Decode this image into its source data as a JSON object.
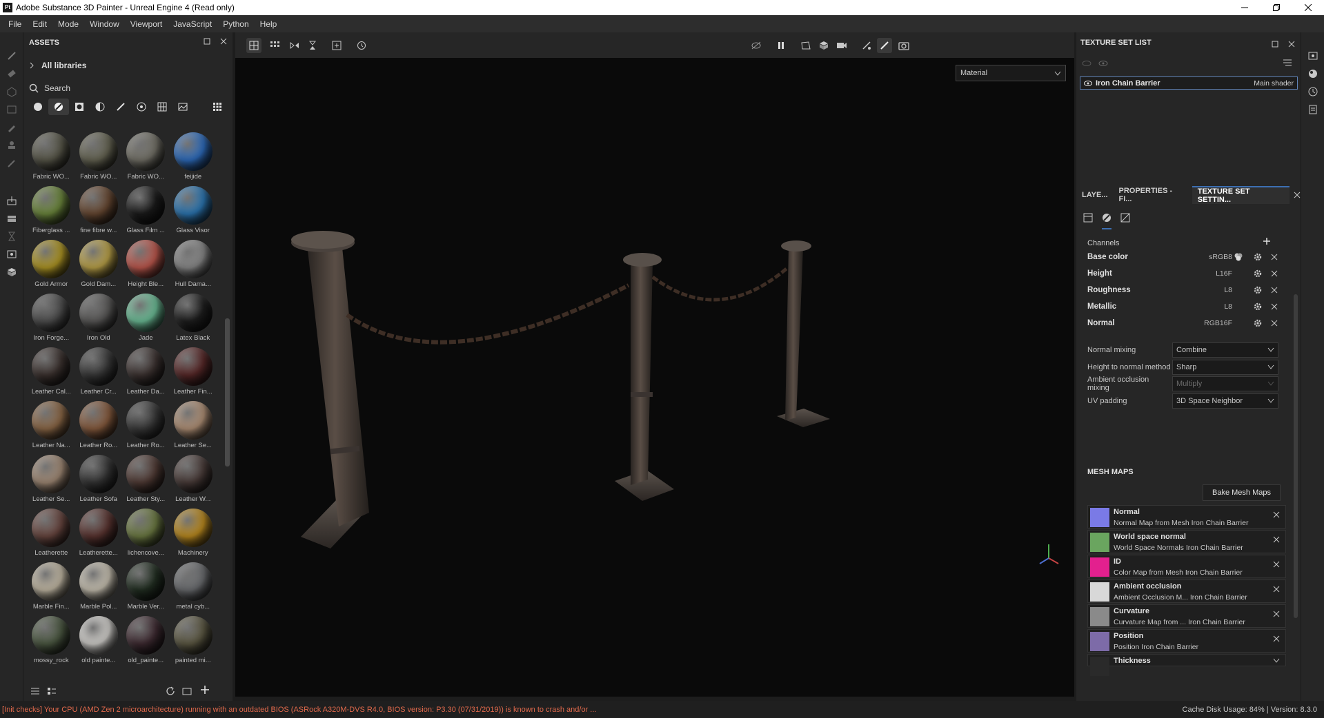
{
  "window": {
    "title": "Adobe Substance 3D Painter - Unreal Engine 4 (Read only)",
    "app_icon": "Pt"
  },
  "menu": [
    "File",
    "Edit",
    "Mode",
    "Window",
    "Viewport",
    "JavaScript",
    "Python",
    "Help"
  ],
  "assets": {
    "title": "ASSETS",
    "libraries_label": "All libraries",
    "search_placeholder": "Search",
    "items": [
      {
        "label": "Fabric WO...",
        "color": "#5b5a4c"
      },
      {
        "label": "Fabric WO...",
        "color": "#686755"
      },
      {
        "label": "Fabric WO...",
        "color": "#76746a"
      },
      {
        "label": "feijide",
        "color": "#2f6fc2"
      },
      {
        "label": "Fiberglass ...",
        "color": "#6f8b3e"
      },
      {
        "label": "fine fibre w...",
        "color": "#6a4a33"
      },
      {
        "label": "Glass Film ...",
        "color": "#1c1c1c"
      },
      {
        "label": "Glass Visor",
        "color": "#2d7ab8"
      },
      {
        "label": "Gold Armor",
        "color": "#b39a25"
      },
      {
        "label": "Gold Dam...",
        "color": "#bfa64a"
      },
      {
        "label": "Height Ble...",
        "color": "#c25a4f"
      },
      {
        "label": "Hull Dama...",
        "color": "#8c8c8c"
      },
      {
        "label": "Iron Forge...",
        "color": "#525252"
      },
      {
        "label": "Iron Old",
        "color": "#5c5b5a"
      },
      {
        "label": "Jade",
        "color": "#6fc39b"
      },
      {
        "label": "Latex Black",
        "color": "#1f1f1f"
      },
      {
        "label": "Leather Cal...",
        "color": "#3d3330"
      },
      {
        "label": "Leather Cr...",
        "color": "#3a3a3a"
      },
      {
        "label": "Leather Da...",
        "color": "#3e3432"
      },
      {
        "label": "Leather Fin...",
        "color": "#5a2929"
      },
      {
        "label": "Leather Na...",
        "color": "#8f6a48"
      },
      {
        "label": "Leather Ro...",
        "color": "#8a5d3f"
      },
      {
        "label": "Leather Ro...",
        "color": "#3b3b3b"
      },
      {
        "label": "Leather Se...",
        "color": "#b59479"
      },
      {
        "label": "Leather Se...",
        "color": "#a58d78"
      },
      {
        "label": "Leather Sofa",
        "color": "#353535"
      },
      {
        "label": "Leather Sty...",
        "color": "#523c36"
      },
      {
        "label": "Leather W...",
        "color": "#4b3d3a"
      },
      {
        "label": "Leatherette",
        "color": "#6b4841"
      },
      {
        "label": "Leatherette...",
        "color": "#5c3531"
      },
      {
        "label": "lichencove...",
        "color": "#6f7d44"
      },
      {
        "label": "Machinery",
        "color": "#c08e20"
      },
      {
        "label": "Marble Fin...",
        "color": "#c7bda8"
      },
      {
        "label": "Marble Pol...",
        "color": "#cdc6b6"
      },
      {
        "label": "Marble Ver...",
        "color": "#233023"
      },
      {
        "label": "metal cyb...",
        "color": "#6d6f72"
      },
      {
        "label": "mossy_rock",
        "color": "#4e5b44"
      },
      {
        "label": "old painte...",
        "color": "#d8d6d2"
      },
      {
        "label": "old_painte...",
        "color": "#402c33"
      },
      {
        "label": "painted mi...",
        "color": "#5f5b45"
      },
      {
        "label": "",
        "color": "#9a9898"
      },
      {
        "label": "",
        "color": "#8b6b4a"
      },
      {
        "label": "",
        "color": "#b3c2bd"
      },
      {
        "label": "",
        "color": "#3c3c3c"
      }
    ]
  },
  "viewport": {
    "display_mode": "Material"
  },
  "texture_set_list": {
    "title": "TEXTURE SET LIST",
    "item_name": "Iron Chain Barrier",
    "item_shader": "Main shader"
  },
  "tabs": [
    {
      "label": "LAYE..."
    },
    {
      "label": "PROPERTIES - FI..."
    },
    {
      "label": "TEXTURE SET SETTIN..."
    }
  ],
  "channels": {
    "title": "Channels",
    "items": [
      {
        "name": "Base color",
        "format": "sRGB8"
      },
      {
        "name": "Height",
        "format": "L16F"
      },
      {
        "name": "Roughness",
        "format": "L8"
      },
      {
        "name": "Metallic",
        "format": "L8"
      },
      {
        "name": "Normal",
        "format": "RGB16F"
      }
    ]
  },
  "properties": [
    {
      "label": "Normal mixing",
      "value": "Combine"
    },
    {
      "label": "Height to normal method",
      "value": "Sharp"
    },
    {
      "label": "Ambient occlusion mixing",
      "value": "Multiply"
    },
    {
      "label": "UV padding",
      "value": "3D Space Neighbor"
    }
  ],
  "mesh_maps": {
    "title": "MESH MAPS",
    "bake_button": "Bake Mesh Maps",
    "items": [
      {
        "name": "Normal",
        "desc": "Normal Map from Mesh Iron Chain Barrier",
        "color": "#7a7ae6"
      },
      {
        "name": "World space normal",
        "desc": "World Space Normals Iron Chain Barrier",
        "color": "#6aa55f"
      },
      {
        "name": "ID",
        "desc": "Color Map from Mesh Iron Chain Barrier",
        "color": "#e3208e"
      },
      {
        "name": "Ambient occlusion",
        "desc": "Ambient Occlusion M... Iron Chain Barrier",
        "color": "#d8d8d8"
      },
      {
        "name": "Curvature",
        "desc": "Curvature Map from ... Iron Chain Barrier",
        "color": "#8a8a8a"
      },
      {
        "name": "Position",
        "desc": "Position Iron Chain Barrier",
        "color": "#7d6ba8"
      },
      {
        "name": "Thickness",
        "desc": "",
        "color": "#2a2a2a"
      }
    ]
  },
  "status": {
    "warning": "[Init checks] Your CPU (AMD Zen 2 microarchitecture) running with an outdated BIOS (ASRock A320M-DVS R4.0, BIOS version: P3.30 (07/31/2019)) is known to crash and/or ...",
    "cache": "Cache Disk Usage:   84%  |  Version: 8.3.0"
  }
}
